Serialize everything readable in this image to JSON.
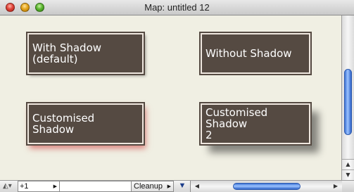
{
  "window": {
    "title": "Map: untitled 12"
  },
  "nodes": [
    {
      "label": "With Shadow\n(default)",
      "shadow": "default"
    },
    {
      "label": "Without Shadow",
      "shadow": "none"
    },
    {
      "label": "Customised Shadow",
      "shadow": "red"
    },
    {
      "label": "Customised Shadow\n2",
      "shadow": "large-offset"
    }
  ],
  "toolbar": {
    "zoom_value": "+1",
    "cleanup_label": "Cleanup"
  },
  "colors": {
    "canvas_bg": "#f0efe3",
    "node_fill": "#554a42",
    "node_text": "#ffffff",
    "red_shadow": "#c82828",
    "scroll_thumb": "#4d82e0"
  },
  "icons": {
    "close": "close-icon",
    "minimize": "minimize-icon",
    "zoom": "zoom-icon",
    "navigator": "navigator-icon",
    "pin": "pin-icon"
  }
}
